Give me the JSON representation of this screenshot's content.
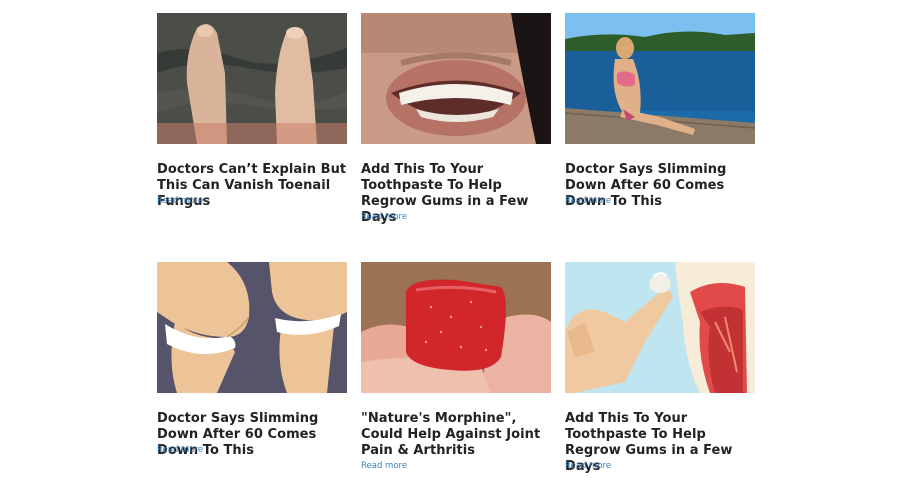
{
  "cards": [
    {
      "title": "Doctors Can’t Explain But This Can Vanish Toenail Fungus",
      "link": "Read more",
      "image_icon": "feet-in-water-photo"
    },
    {
      "title": "Add This To Your Toothpaste To Help Regrow Gums in a Few Days",
      "link": "Read more",
      "image_icon": "smiling-teeth-photo"
    },
    {
      "title": "Doctor Says Slimming Down After 60 Comes Down To This",
      "link": "Read more",
      "image_icon": "woman-on-dock-lake-photo"
    },
    {
      "title": "Doctor Says Slimming Down After 60 Comes Down To This",
      "link": "Read more",
      "image_icon": "legs-illustration"
    },
    {
      "title": "\"Nature's Morphine\", Could Help Against Joint Pain & Arthritis",
      "link": "Read more",
      "image_icon": "red-gummy-photo"
    },
    {
      "title": "Add This To Your Toothpaste To Help Regrow Gums in a Few Days",
      "link": "Read more",
      "image_icon": "tooth-illustration"
    }
  ],
  "colors": {
    "title": "#222222",
    "link": "#3a82c4",
    "background": "#ffffff"
  }
}
